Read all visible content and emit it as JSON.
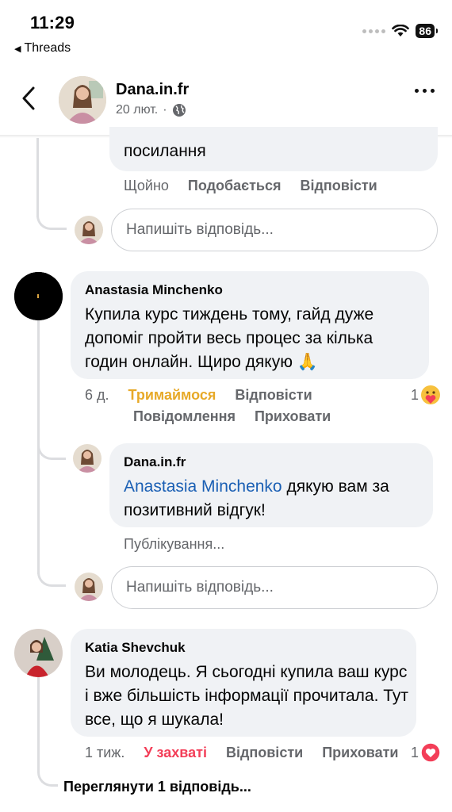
{
  "status_bar": {
    "time": "11:29",
    "back_app": "Threads",
    "battery": "86",
    "icons": [
      "cellular-dots-icon",
      "wifi-icon",
      "battery-icon"
    ]
  },
  "header": {
    "name": "Dana.in.fr",
    "date": "20 лют.",
    "separator": "·",
    "icons": [
      "back-chevron-icon",
      "globe-icon",
      "more-dots-icon"
    ]
  },
  "top_partial": {
    "text": "посилання",
    "time": "Щойно",
    "like": "Подобається",
    "reply": "Відповісти",
    "reply_placeholder": "Напишіть відповідь..."
  },
  "comment1": {
    "author": "Anastasia Minchenko",
    "text": "Купила курс тиждень тому, гайд дуже допоміг пройти весь процес за кілька годин онлайн. Щиро дякую",
    "emoji": "🙏",
    "time": "6 д.",
    "reaction_label": "Тримаймося",
    "reaction_color": "#e7a928",
    "reply": "Відповісти",
    "message": "Повідомлення",
    "hide": "Приховати",
    "reaction_count": "1",
    "reaction_icon": "care-reaction-icon"
  },
  "reply1": {
    "author": "Dana.in.fr",
    "mention": "Anastasia Minchenko",
    "text": " дякую вам за позитивний відгук!",
    "status": "Публікування...",
    "reply_placeholder": "Напишіть відповідь..."
  },
  "comment2": {
    "author": "Katia Shevchuk",
    "text": "Ви молодець. Я сьогодні купила ваш курс і вже більшість інформації прочитала. Тут все, що я шукала!",
    "time": "1 тиж.",
    "reaction_label": "У захваті",
    "reaction_color": "#f33e58",
    "reply": "Відповісти",
    "hide": "Приховати",
    "reaction_count": "1",
    "reaction_icon": "love-reaction-icon"
  },
  "view_replies": "Переглянути 1 відповідь..."
}
